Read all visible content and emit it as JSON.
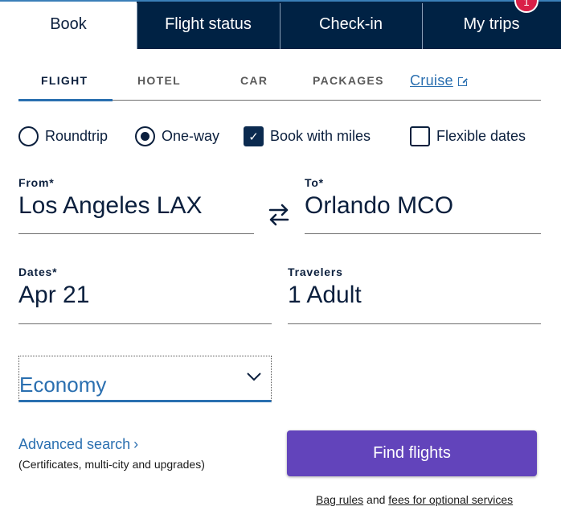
{
  "top_tabs": {
    "book": "Book",
    "flight_status": "Flight status",
    "check_in": "Check-in",
    "my_trips": "My trips",
    "my_trips_badge": "1",
    "active": "Book"
  },
  "sub_tabs": {
    "flight": "FLIGHT",
    "hotel": "HOTEL",
    "car": "CAR",
    "packages": "PACKAGES",
    "cruise": "Cruise",
    "active": "FLIGHT"
  },
  "options": {
    "roundtrip": {
      "label": "Roundtrip",
      "checked": false
    },
    "one_way": {
      "label": "One-way",
      "checked": true
    },
    "book_with_miles": {
      "label": "Book with miles",
      "checked": true
    },
    "flexible_dates": {
      "label": "Flexible dates",
      "checked": false
    }
  },
  "fields": {
    "from": {
      "label": "From*",
      "value": "Los Angeles LAX"
    },
    "to": {
      "label": "To*",
      "value": "Orlando MCO"
    },
    "dates": {
      "label": "Dates*",
      "value": "Apr 21"
    },
    "travelers": {
      "label": "Travelers",
      "value": "1 Adult"
    },
    "cabin": {
      "value": "Economy"
    }
  },
  "advanced": {
    "link": "Advanced search",
    "subtext": "(Certificates, multi-city and upgrades)"
  },
  "find_button": "Find flights",
  "footer": {
    "bag_rules": "Bag rules",
    "and": " and ",
    "fees": "fees for optional services"
  },
  "colors": {
    "navy": "#002244",
    "accent_blue": "#2a6fb0",
    "button_purple": "#6244bb",
    "badge_red": "#d91f47"
  }
}
